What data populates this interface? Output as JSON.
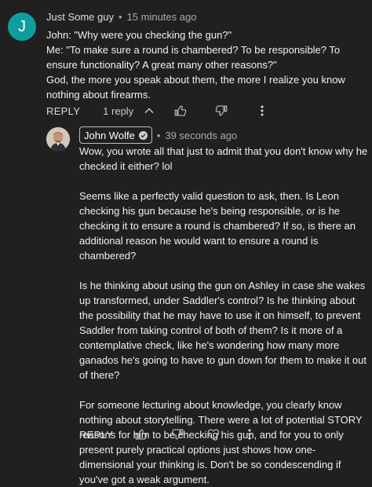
{
  "parent_comment": {
    "avatar_letter": "J",
    "author": "Just Some guy",
    "separator": "•",
    "timestamp": "15 minutes ago",
    "paragraphs": [
      "John: \"Why were you checking the gun?\"\nMe: \"To make sure a round is chambered? To be responsible? To ensure functionality? A great many other reasons?\"\nGod, the more you speak about them, the more I realize you know nothing about firearms."
    ],
    "reply_label": "REPLY",
    "replies_count_label": "1 reply"
  },
  "reply_comment": {
    "author": "John Wolfe",
    "separator": "•",
    "timestamp": "39 seconds ago",
    "paragraphs": [
      "Wow, you wrote all that just to admit that you don't know why he checked it either? lol",
      "Seems like a perfectly valid question to ask, then. Is Leon checking his gun because he's being responsible, or is he checking it to ensure a round is chambered? If so, is there an additional reason he would want to ensure a round is chambered?",
      "Is he thinking about using the gun on Ashley in case she wakes up transformed, under Saddler's control? Is he thinking about the possibility that he may have to use it on himself, to prevent Saddler from taking control of both of them? Is it more of a contemplative check, like he's wondering how many more ganados he's going to have to gun down for them to make it out of there?",
      "For someone lecturing about knowledge, you clearly know nothing about storytelling. There were a lot of potential STORY reasons for him to be checking his gun, and for you to only present purely practical options just shows how one-dimensional your thinking is. Don't be so condescending if you've got a weak argument."
    ],
    "reply_label": "REPLY"
  },
  "icons": {
    "thumbs_up": "thumbs-up-icon",
    "thumbs_down": "thumbs-down-icon",
    "more": "more-vert-icon",
    "chevron_up": "chevron-up-icon",
    "heart": "heart-icon",
    "verified": "verified-check-icon"
  },
  "colors": {
    "background": "#202020",
    "avatar_j": "#0f9d9f",
    "text": "#f1f1f1",
    "meta": "#aaaaaa"
  }
}
